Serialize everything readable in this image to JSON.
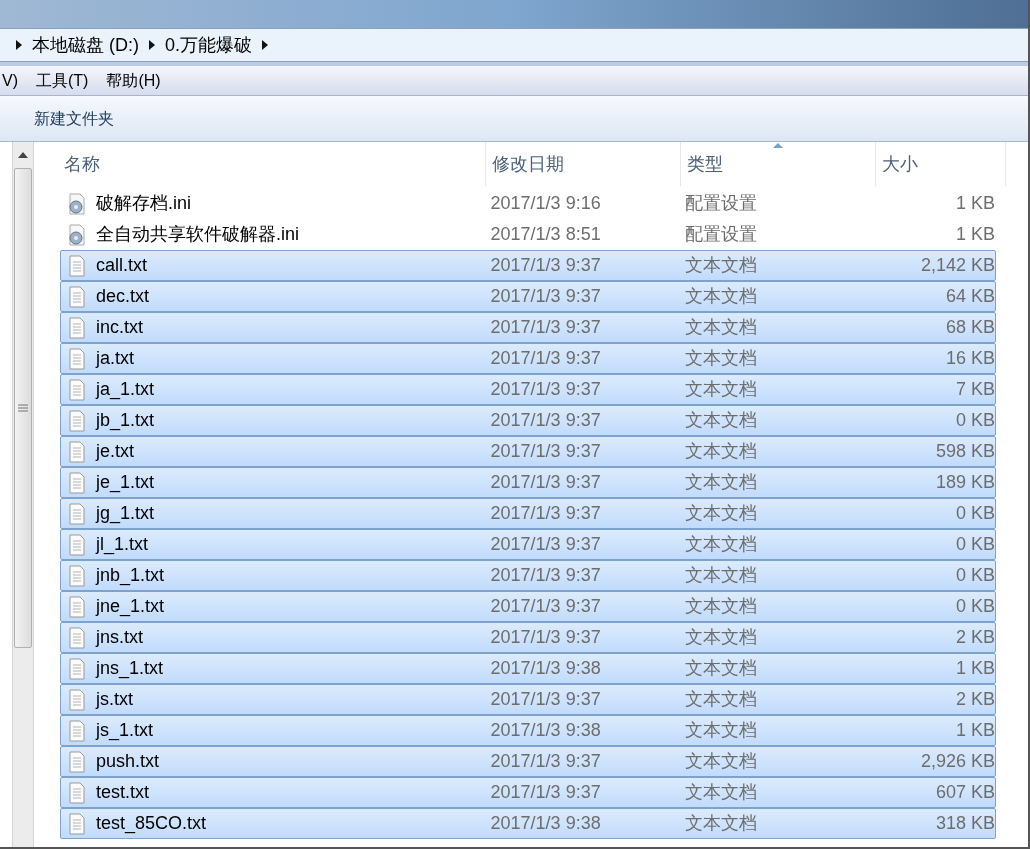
{
  "address_bar": {
    "crumbs": [
      "本地磁盘 (D:)",
      "0.万能爆破"
    ]
  },
  "menu_bar": [
    "V)",
    "工具(T)",
    "帮助(H)"
  ],
  "toolbar": {
    "buttons": [
      "新建文件夹"
    ]
  },
  "file_list": {
    "columns": [
      {
        "label": "名称",
        "sorted": false
      },
      {
        "label": "修改日期",
        "sorted": false
      },
      {
        "label": "类型",
        "sorted": true
      },
      {
        "label": "大小",
        "sorted": false
      }
    ],
    "rows": [
      {
        "name": "破解存档.ini",
        "modified": "2017/1/3 9:16",
        "type": "配置设置",
        "size": "1 KB",
        "kind": "ini",
        "selected": false
      },
      {
        "name": "全自动共享软件破解器.ini",
        "modified": "2017/1/3 8:51",
        "type": "配置设置",
        "size": "1 KB",
        "kind": "ini",
        "selected": false
      },
      {
        "name": "call.txt",
        "modified": "2017/1/3 9:37",
        "type": "文本文档",
        "size": "2,142 KB",
        "kind": "txt",
        "selected": true
      },
      {
        "name": "dec.txt",
        "modified": "2017/1/3 9:37",
        "type": "文本文档",
        "size": "64 KB",
        "kind": "txt",
        "selected": true
      },
      {
        "name": "inc.txt",
        "modified": "2017/1/3 9:37",
        "type": "文本文档",
        "size": "68 KB",
        "kind": "txt",
        "selected": true
      },
      {
        "name": "ja.txt",
        "modified": "2017/1/3 9:37",
        "type": "文本文档",
        "size": "16 KB",
        "kind": "txt",
        "selected": true
      },
      {
        "name": "ja_1.txt",
        "modified": "2017/1/3 9:37",
        "type": "文本文档",
        "size": "7 KB",
        "kind": "txt",
        "selected": true
      },
      {
        "name": "jb_1.txt",
        "modified": "2017/1/3 9:37",
        "type": "文本文档",
        "size": "0 KB",
        "kind": "txt",
        "selected": true
      },
      {
        "name": "je.txt",
        "modified": "2017/1/3 9:37",
        "type": "文本文档",
        "size": "598 KB",
        "kind": "txt",
        "selected": true
      },
      {
        "name": "je_1.txt",
        "modified": "2017/1/3 9:37",
        "type": "文本文档",
        "size": "189 KB",
        "kind": "txt",
        "selected": true
      },
      {
        "name": "jg_1.txt",
        "modified": "2017/1/3 9:37",
        "type": "文本文档",
        "size": "0 KB",
        "kind": "txt",
        "selected": true
      },
      {
        "name": "jl_1.txt",
        "modified": "2017/1/3 9:37",
        "type": "文本文档",
        "size": "0 KB",
        "kind": "txt",
        "selected": true
      },
      {
        "name": "jnb_1.txt",
        "modified": "2017/1/3 9:37",
        "type": "文本文档",
        "size": "0 KB",
        "kind": "txt",
        "selected": true
      },
      {
        "name": "jne_1.txt",
        "modified": "2017/1/3 9:37",
        "type": "文本文档",
        "size": "0 KB",
        "kind": "txt",
        "selected": true
      },
      {
        "name": "jns.txt",
        "modified": "2017/1/3 9:37",
        "type": "文本文档",
        "size": "2 KB",
        "kind": "txt",
        "selected": true
      },
      {
        "name": "jns_1.txt",
        "modified": "2017/1/3 9:38",
        "type": "文本文档",
        "size": "1 KB",
        "kind": "txt",
        "selected": true
      },
      {
        "name": "js.txt",
        "modified": "2017/1/3 9:37",
        "type": "文本文档",
        "size": "2 KB",
        "kind": "txt",
        "selected": true
      },
      {
        "name": "js_1.txt",
        "modified": "2017/1/3 9:38",
        "type": "文本文档",
        "size": "1 KB",
        "kind": "txt",
        "selected": true
      },
      {
        "name": "push.txt",
        "modified": "2017/1/3 9:37",
        "type": "文本文档",
        "size": "2,926 KB",
        "kind": "txt",
        "selected": true
      },
      {
        "name": "test.txt",
        "modified": "2017/1/3 9:37",
        "type": "文本文档",
        "size": "607 KB",
        "kind": "txt",
        "selected": true
      },
      {
        "name": "test_85CO.txt",
        "modified": "2017/1/3 9:38",
        "type": "文本文档",
        "size": "318 KB",
        "kind": "txt",
        "selected": true
      }
    ]
  }
}
